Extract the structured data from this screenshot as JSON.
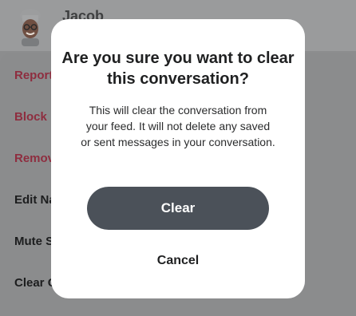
{
  "header": {
    "contact_name": "Jacob",
    "avatar_icon": "bitmoji-avatar-icon"
  },
  "menu": {
    "items": [
      {
        "label": "Report",
        "color": "#8e2d3f"
      },
      {
        "label": "Block",
        "color": "#8e2d3f"
      },
      {
        "label": "Remove",
        "color": "#8e2d3f"
      },
      {
        "label": "Edit Name",
        "color": "#1c1d1e"
      },
      {
        "label": "Mute Story",
        "color": "#1c1d1e"
      },
      {
        "label": "Clear Conversation",
        "color": "#1c1d1e"
      }
    ]
  },
  "dialog": {
    "title": "Are you sure you want to clear this conversation?",
    "body": "This will clear the conversation from your feed. It will not delete any saved or sent messages in your conversation.",
    "confirm_label": "Clear",
    "cancel_label": "Cancel",
    "confirm_color": "#4b5159"
  }
}
